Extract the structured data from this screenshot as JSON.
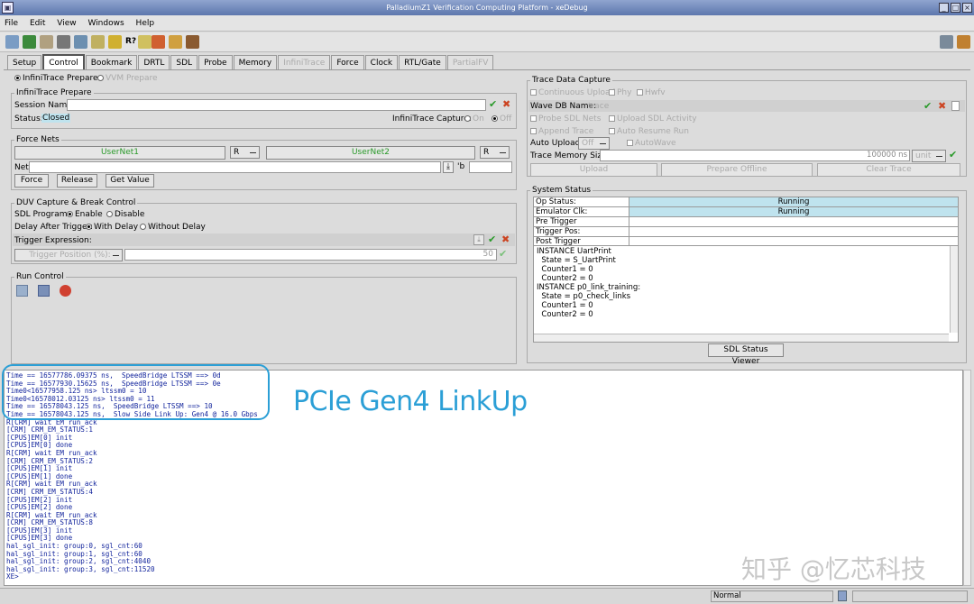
{
  "window": {
    "title": "PalladiumZ1 Verification Computing Platform - xeDebug"
  },
  "menu": [
    "File",
    "Edit",
    "View",
    "Windows",
    "Help"
  ],
  "toolbar": {
    "help_label": "R?"
  },
  "tabs": [
    {
      "label": "Setup",
      "state": "normal"
    },
    {
      "label": "Control",
      "state": "selected"
    },
    {
      "label": "Bookmark",
      "state": "normal"
    },
    {
      "label": "DRTL",
      "state": "normal"
    },
    {
      "label": "SDL",
      "state": "normal"
    },
    {
      "label": "Probe",
      "state": "normal"
    },
    {
      "label": "Memory",
      "state": "normal"
    },
    {
      "label": "InfiniTrace",
      "state": "disabled"
    },
    {
      "label": "Force",
      "state": "normal"
    },
    {
      "label": "Clock",
      "state": "normal"
    },
    {
      "label": "RTL/Gate",
      "state": "normal"
    },
    {
      "label": "PartialFV",
      "state": "disabled"
    }
  ],
  "mode": {
    "infinitrace_prepare": "InfiniTrace Prepare",
    "vvm_prepare": "VVM Prepare"
  },
  "infinitrace": {
    "title": "InfiniTrace Prepare",
    "session_label": "Session Name:",
    "status_label": "Status:",
    "status_value": "Closed",
    "capture_label": "InfiniTrace Capture:",
    "on": "On",
    "off": "Off"
  },
  "force_nets": {
    "title": "Force Nets",
    "net1": "UserNet1",
    "net2": "UserNet2",
    "r1": "R",
    "r2": "R",
    "net_label": "Net:",
    "suffix": "'b",
    "force": "Force",
    "release": "Release",
    "get_value": "Get Value"
  },
  "duv": {
    "title": "DUV Capture & Break Control",
    "sdl_label": "SDL Program:",
    "enable": "Enable",
    "disable": "Disable",
    "delay_label": "Delay After Trigger:",
    "with_delay": "With Delay",
    "without_delay": "Without Delay",
    "trigger_expr": "Trigger Expression:",
    "trigger_pos": "Trigger Position (%):",
    "trigger_pos_value": "50"
  },
  "run_control": {
    "title": "Run Control"
  },
  "trace": {
    "title": "Trace Data Capture",
    "continuous": "Continuous Upload",
    "phy": "Phy",
    "hwfv": "Hwfv",
    "wave_db_label": "Wave DB Name:",
    "wave_db_value": "trace",
    "probe_sdl": "Probe SDL Nets",
    "upload_sdl": "Upload SDL Activity",
    "append": "Append Trace",
    "auto_resume": "Auto Resume Run",
    "auto_upload_label": "Auto Upload:",
    "auto_upload_value": "Off",
    "autowave": "AutoWave",
    "mem_label": "Trace Memory Size:",
    "mem_value": "100000 ns",
    "mem_unit": "unit",
    "upload": "Upload",
    "prepare_offline": "Prepare Offline",
    "clear_trace": "Clear Trace"
  },
  "system_status": {
    "title": "System Status",
    "rows": [
      {
        "label": "Op Status:",
        "value": "Running",
        "highlight": true
      },
      {
        "label": "Emulator Clk:",
        "value": "Running",
        "highlight": true
      },
      {
        "label": "Pre Trigger",
        "value": "",
        "highlight": false
      },
      {
        "label": "Trigger Pos:",
        "value": "",
        "highlight": false
      },
      {
        "label": "Post Trigger",
        "value": "",
        "highlight": false
      }
    ],
    "instances": [
      "INSTANCE UartPrint",
      "  State = S_UartPrint",
      "  Counter1 = 0",
      "  Counter2 = 0",
      "INSTANCE p0_link_training:",
      "  State = p0_check_links",
      "  Counter1 = 0",
      "  Counter2 = 0"
    ],
    "viewer_button": "SDL Status Viewer"
  },
  "console": {
    "lines": [
      "Time == 16577786.09375 ns,  SpeedBridge LTSSM ==> 0d",
      "Time == 16577930.15625 ns,  SpeedBridge LTSSM ==> 0e",
      "Time0<16577958.125 ns> ltssm0 = 10",
      "Time0<16578012.03125 ns> ltssm0 = 11",
      "Time == 16578043.125 ns,  SpeedBridge LTSSM ==> 10",
      "Time == 16578043.125 ns,  Slow Side Link Up: Gen4 @ 16.0 Gbps",
      "R[CRM] wait EM run_ack",
      "[CRM] CRM_EM_STATUS:1",
      "[CPUS]EM[0] init",
      "[CPUS]EM[0] done",
      "R[CRM] wait EM run_ack",
      "[CRM] CRM_EM_STATUS:2",
      "[CPUS]EM[1] init",
      "[CPUS]EM[1] done",
      "R[CRM] wait EM run_ack",
      "[CRM] CRM_EM_STATUS:4",
      "[CPUS]EM[2] init",
      "[CPUS]EM[2] done",
      "R[CRM] wait EM run_ack",
      "[CRM] CRM_EM_STATUS:8",
      "[CPUS]EM[3] init",
      "[CPUS]EM[3] done",
      "hal_sgl_init: group:0, sgl_cnt:60",
      "hal_sgl_init: group:1, sgl_cnt:60",
      "hal_sgl_init: group:2, sgl_cnt:4040",
      "hal_sgl_init: group:3, sgl_cnt:11520",
      "XE>"
    ]
  },
  "annotation": "PCIe Gen4 LinkUp",
  "watermark": "知乎 @忆芯科技",
  "statusbar": {
    "mode": "Normal"
  },
  "colors": {
    "accent": "#2b9fd6",
    "running_bg": "#bfe3ee",
    "console_text": "#12249c"
  }
}
